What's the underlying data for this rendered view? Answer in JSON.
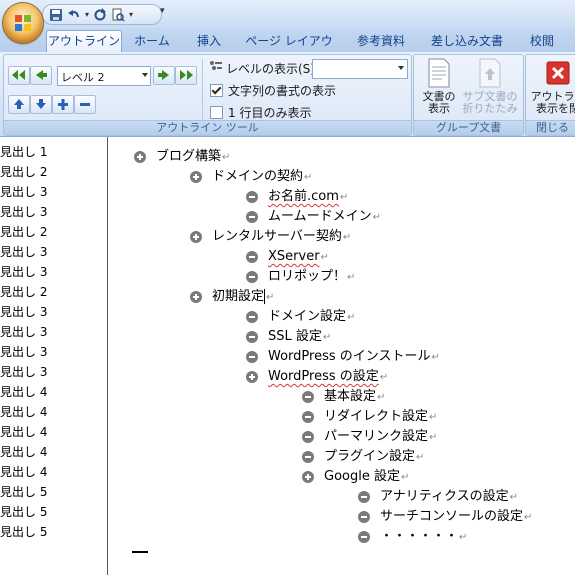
{
  "ribbon_tabs": [
    "アウトライン",
    "ホーム",
    "挿入",
    "ページ レイアウト",
    "参考資料",
    "差し込み文書",
    "校閲"
  ],
  "outline_tools": {
    "level_value": "レベル 2",
    "show_level_label": "レベルの表示(S):",
    "show_level_value": "",
    "show_text_format_label": "文字列の書式の表示",
    "show_text_format_checked": true,
    "first_line_only_label": "1 行目のみ表示",
    "first_line_only_checked": false,
    "group_label": "アウトライン ツール"
  },
  "master_document": {
    "show_document_label": [
      "文書の",
      "表示"
    ],
    "collapse_subdocs_label": [
      "サブ文書の",
      "折りたたみ"
    ],
    "group_label": "グループ文書"
  },
  "close_group": {
    "close_outline_label": [
      "アウトライ",
      "表示を閉"
    ],
    "group_label": "閉じる"
  },
  "style_pane": [
    "見出し 1",
    "見出し 2",
    "見出し 3",
    "見出し 3",
    "見出し 2",
    "見出し 3",
    "見出し 3",
    "見出し 2",
    "見出し 3",
    "見出し 3",
    "見出し 3",
    "見出し 3",
    "見出し 4",
    "見出し 4",
    "見出し 4",
    "見出し 4",
    "見出し 4",
    "見出し 5",
    "見出し 5",
    "見出し 5"
  ],
  "outline": [
    {
      "text": "ブログ構築",
      "level": 1,
      "bullet": "plus"
    },
    {
      "text": "ドメインの契約",
      "level": 2,
      "bullet": "plus"
    },
    {
      "text": "お名前.com",
      "level": 3,
      "bullet": "minus",
      "squiggle": true
    },
    {
      "text": "ムームードメイン",
      "level": 3,
      "bullet": "minus"
    },
    {
      "text": "レンタルサーバー契約",
      "level": 2,
      "bullet": "plus"
    },
    {
      "text": "XServer",
      "level": 3,
      "bullet": "minus",
      "squiggle": true
    },
    {
      "text": "ロリポップ！",
      "level": 3,
      "bullet": "minus"
    },
    {
      "text": "初期設定",
      "level": 2,
      "bullet": "plus",
      "cursor": true
    },
    {
      "text": "ドメイン設定",
      "level": 3,
      "bullet": "minus"
    },
    {
      "text": "SSL 設定",
      "level": 3,
      "bullet": "minus"
    },
    {
      "text": "WordPress のインストール",
      "level": 3,
      "bullet": "minus"
    },
    {
      "text": "WordPress の設定",
      "level": 3,
      "bullet": "plus",
      "squiggle": true
    },
    {
      "text": "基本設定",
      "level": 4,
      "bullet": "minus"
    },
    {
      "text": "リダイレクト設定",
      "level": 4,
      "bullet": "minus"
    },
    {
      "text": "パーマリンク設定",
      "level": 4,
      "bullet": "minus"
    },
    {
      "text": "プラグイン設定",
      "level": 4,
      "bullet": "minus"
    },
    {
      "text": "Google 設定",
      "level": 4,
      "bullet": "plus"
    },
    {
      "text": "アナリティクスの設定",
      "level": 5,
      "bullet": "minus"
    },
    {
      "text": "サーチコンソールの設定",
      "level": 5,
      "bullet": "minus"
    },
    {
      "text": "・・・・・・",
      "level": 5,
      "bullet": "minus"
    }
  ],
  "paragraph_mark": "↵",
  "colors": {
    "ribbon_tab_text": "#15428b",
    "squiggle": "#d23a3a",
    "bullet": "#7a7a7a"
  }
}
